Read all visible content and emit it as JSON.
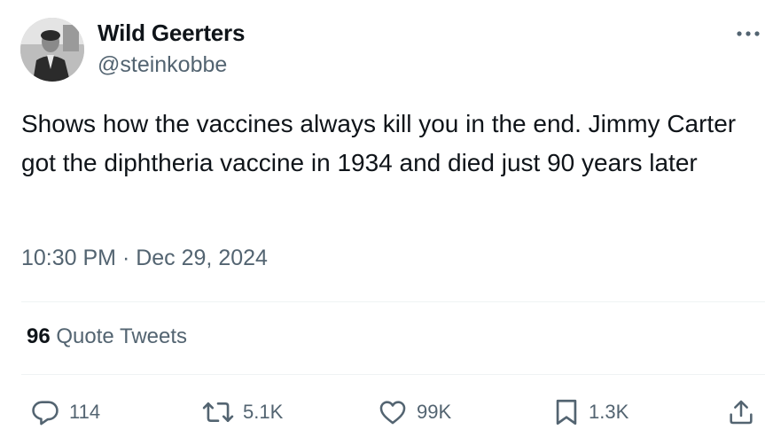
{
  "author": {
    "display_name": "Wild Geerters",
    "handle": "@steinkobbe"
  },
  "tweet": {
    "text": "Shows how the vaccines always kill you in the end. Jimmy Carter got the diphtheria vaccine in 1934 and died just 90 years later",
    "timestamp": "10:30 PM · Dec 29, 2024"
  },
  "quote_tweets": {
    "count": "96",
    "label": "Quote Tweets"
  },
  "actions": {
    "replies": "114",
    "retweets": "5.1K",
    "likes": "99K",
    "bookmarks": "1.3K"
  },
  "icons": {
    "more": "more-dots-icon",
    "reply": "reply-bubble-icon",
    "retweet": "retweet-arrows-icon",
    "like": "heart-icon",
    "bookmark": "bookmark-icon",
    "share": "share-upload-icon"
  },
  "colors": {
    "text_primary": "#0f1419",
    "text_secondary": "#536471",
    "divider": "#eff3f4",
    "background": "#ffffff"
  }
}
